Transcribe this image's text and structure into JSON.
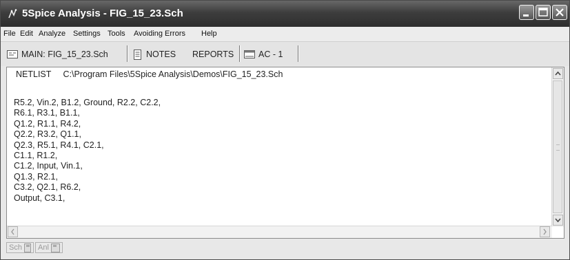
{
  "window": {
    "title": "5Spice Analysis - FIG_15_23.Sch"
  },
  "menu": {
    "items": [
      "File",
      "Edit",
      "Analyze",
      "Settings",
      "Tools",
      "Avoiding Errors",
      "Help"
    ]
  },
  "tabs": [
    {
      "label": "MAIN: FIG_15_23.Sch",
      "icon": "schematic-icon"
    },
    {
      "label": "NOTES",
      "icon": "notes-icon"
    },
    {
      "label": "REPORTS",
      "icon": ""
    },
    {
      "label": "AC - 1",
      "icon": "plot-icon"
    }
  ],
  "active_tab": "REPORTS",
  "report": {
    "header_label": "NETLIST",
    "file_path": "C:\\Program Files\\5Spice Analysis\\Demos\\FIG_15_23.Sch",
    "lines": [
      "R5.2, Vin.2, B1.2, Ground, R2.2, C2.2,",
      "R6.1, R3.1, B1.1,",
      "Q1.2, R1.1, R4.2,",
      "Q2.2, R3.2, Q1.1,",
      "Q2.3, R5.1, R4.1, C2.1,",
      "C1.1, R1.2,",
      "C1.2, Input, Vin.1,",
      "Q1.3, R2.1,",
      "C3.2, Q2.1, R6.2,",
      "Output, C3.1,"
    ]
  },
  "status": {
    "sch_label": "Sch",
    "anl_label": "Anl"
  }
}
